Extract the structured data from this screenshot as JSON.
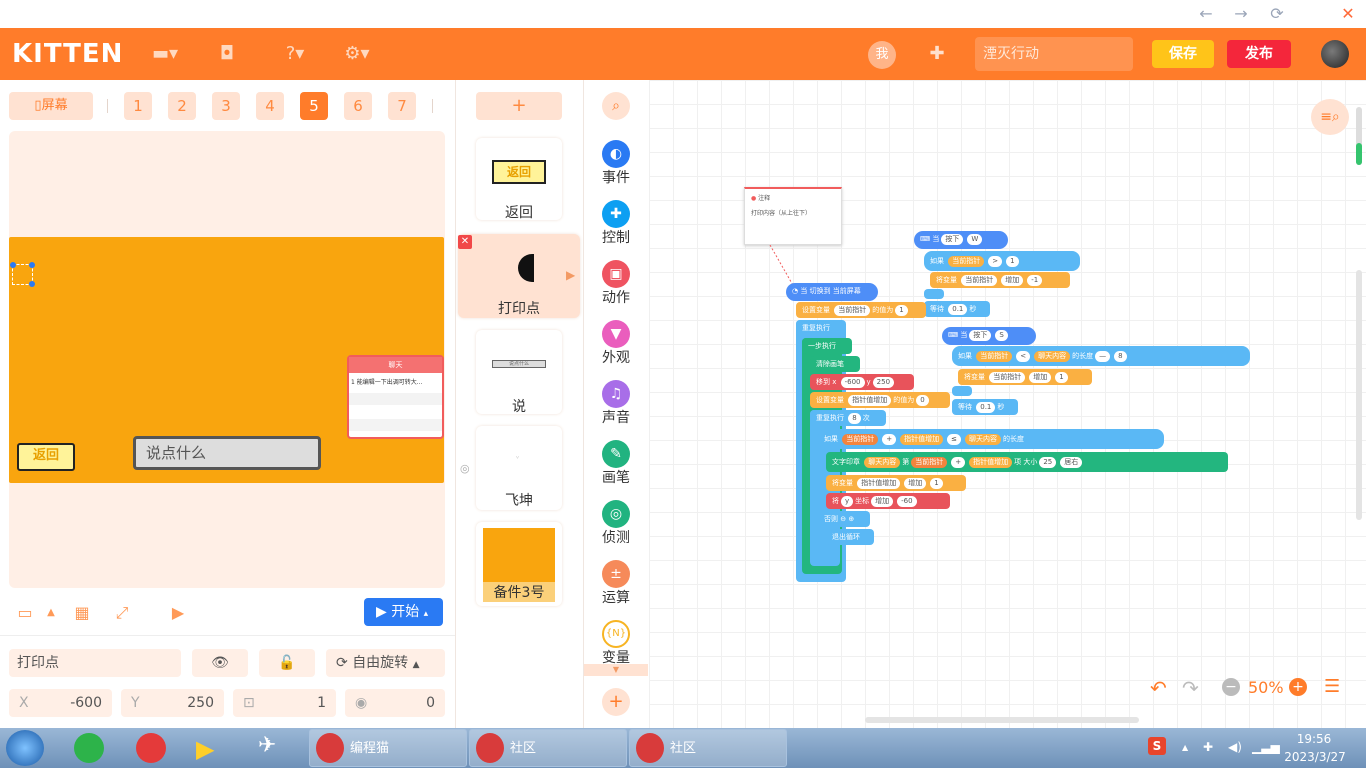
{
  "app": {
    "logo": "KITTEN"
  },
  "window": {
    "back": "←",
    "forward": "→",
    "refresh": "⟳",
    "close": "✕"
  },
  "topbar": {
    "me_label": "我",
    "project_name": "湮灭行动",
    "save_label": "保存",
    "publish_label": "发布"
  },
  "screens": {
    "screen_label": "屏幕",
    "tabs": [
      "1",
      "2",
      "3",
      "4",
      "5",
      "6",
      "7"
    ],
    "active": "5"
  },
  "stage": {
    "back_sprite_label": "返回",
    "say_placeholder": "说点什么",
    "chat_title": "聊天",
    "chat_line": "1 能编辑一下出调可转大..."
  },
  "controls": {
    "start_label": "开始"
  },
  "properties": {
    "name": "打印点",
    "rotation_label": "自由旋转",
    "x_label": "X",
    "x": "-600",
    "y_label": "Y",
    "y": "250",
    "scale": "1",
    "direction": "0"
  },
  "sprites": [
    {
      "name": "返回",
      "thumb_text": "返回"
    },
    {
      "name": "打印点"
    },
    {
      "name": "说",
      "thumb_text": "说点什么"
    },
    {
      "name": "飞坤"
    },
    {
      "name": "备件3号"
    }
  ],
  "categories": [
    {
      "label": "事件",
      "color": "#2a7af3"
    },
    {
      "label": "控制",
      "color": "#0d9ff2"
    },
    {
      "label": "动作",
      "color": "#ef5361"
    },
    {
      "label": "外观",
      "color": "#ea5ebd"
    },
    {
      "label": "声音",
      "color": "#a86ee8"
    },
    {
      "label": "画笔",
      "color": "#21b380"
    },
    {
      "label": "侦测",
      "color": "#21b380"
    },
    {
      "label": "运算",
      "color": "#f68a5a"
    },
    {
      "label": "变量",
      "color": "#f7b423"
    }
  ],
  "comment": {
    "title": "注释",
    "text": "打印内容（从上往下）"
  },
  "blocks": {
    "when_key_w": [
      "当",
      "按下",
      "W"
    ],
    "if1": [
      "如果",
      "当前指针",
      ">",
      "1"
    ],
    "change1": [
      "将变量",
      "当前指针",
      "增加",
      "-1"
    ],
    "wait1": [
      "等待",
      "0.1",
      "秒"
    ],
    "when_key_s": [
      "当",
      "按下",
      "S"
    ],
    "if2": [
      "如果",
      "当前指针",
      "<",
      "聊天内容",
      "的长度",
      "—",
      "8"
    ],
    "change2": [
      "将变量",
      "当前指针",
      "增加",
      "1"
    ],
    "wait2": [
      "等待",
      "0.1",
      "秒"
    ],
    "when_switch": [
      "当 切换到 当前屏幕"
    ],
    "set_var": [
      "设置变量",
      "当前指针",
      "的值为",
      "1"
    ],
    "repeat_forever": [
      "重复执行"
    ],
    "step_exec": [
      "一步执行"
    ],
    "clear_pen": [
      "清除画笔"
    ],
    "move_to": [
      "移到 x",
      "-600",
      "y",
      "250"
    ],
    "set_var2": [
      "设置变量",
      "指针值增加",
      "的值为",
      "0"
    ],
    "repeat_n": [
      "重复执行",
      "8",
      "次"
    ],
    "if3": [
      "如果",
      "当前指针",
      "+",
      "指针值增加",
      "≤",
      "聊天内容",
      "的长度"
    ],
    "print_text": [
      "文字印章",
      "聊天内容",
      "第",
      "当前指针",
      "+",
      "指针值增加",
      "项",
      "大小",
      "25",
      "居右"
    ],
    "change3": [
      "将变量",
      "指针值增加",
      "增加",
      "1"
    ],
    "move_y": [
      "将",
      "y",
      "坐标",
      "增加",
      "-60"
    ],
    "else_label": [
      "否则"
    ],
    "break_loop": [
      "退出循环"
    ]
  },
  "zoom": {
    "level": "50%"
  },
  "taskbar": {
    "items": [
      "编程猫",
      "社区",
      "社区"
    ],
    "time": "19:56",
    "date": "2023/3/27"
  }
}
